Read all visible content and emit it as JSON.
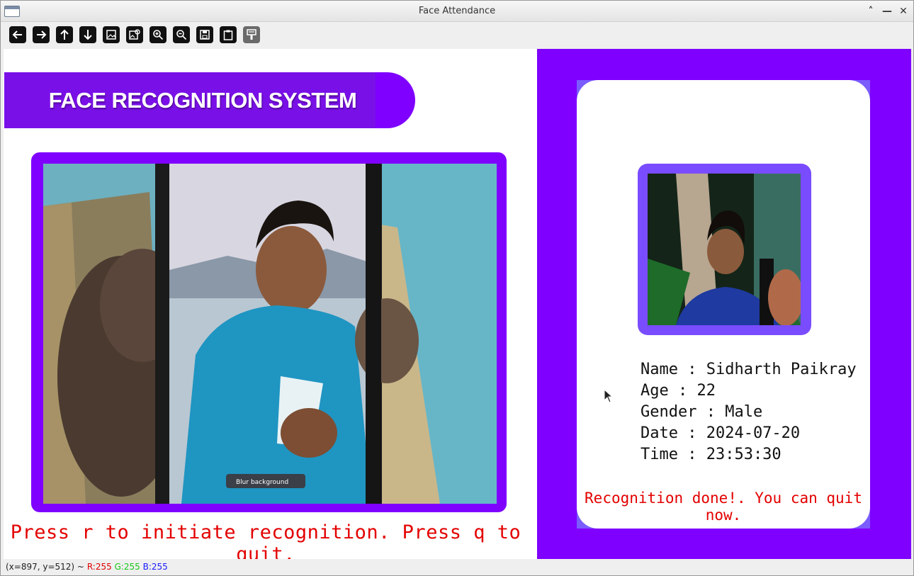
{
  "window": {
    "title": "Face Attendance"
  },
  "toolbar": {
    "buttons": [
      {
        "name": "pan-left-button",
        "icon": "arrow-left-icon"
      },
      {
        "name": "pan-right-button",
        "icon": "arrow-right-icon"
      },
      {
        "name": "pan-up-button",
        "icon": "arrow-up-icon"
      },
      {
        "name": "pan-down-button",
        "icon": "arrow-down-icon"
      },
      {
        "name": "zoom-in-image-button",
        "icon": "image-icon"
      },
      {
        "name": "zoom-original-button",
        "icon": "image-zoom-icon"
      },
      {
        "name": "zoom-in-button",
        "icon": "zoom-in-icon"
      },
      {
        "name": "zoom-out-button",
        "icon": "zoom-out-icon"
      },
      {
        "name": "save-button",
        "icon": "save-icon"
      },
      {
        "name": "copy-clipboard-button",
        "icon": "clipboard-icon"
      },
      {
        "name": "properties-button",
        "icon": "paint-brush-icon"
      }
    ]
  },
  "banner": {
    "text": "FACE RECOGNITION SYSTEM"
  },
  "instructions": "Press r to initiate recognition. Press q to quit.",
  "profile": {
    "name_line": "Name : Sidharth Paikray",
    "age_line": "Age : 22",
    "gender_line": "Gender : Male",
    "date_line": "Date : 2024-07-20",
    "time_line": "Time : 23:53:30"
  },
  "status_message": "Recognition done!. You can quit now.",
  "camera_overlay": {
    "blur_label": "Blur background"
  },
  "statusbar": {
    "coords": "(x=897, y=512) ~",
    "r": "R:255",
    "g": "G:255",
    "b": "B:255"
  },
  "colors": {
    "accent": "#7f00ff",
    "photo_frame": "#7a4cff",
    "alert_text": "#e30000"
  }
}
